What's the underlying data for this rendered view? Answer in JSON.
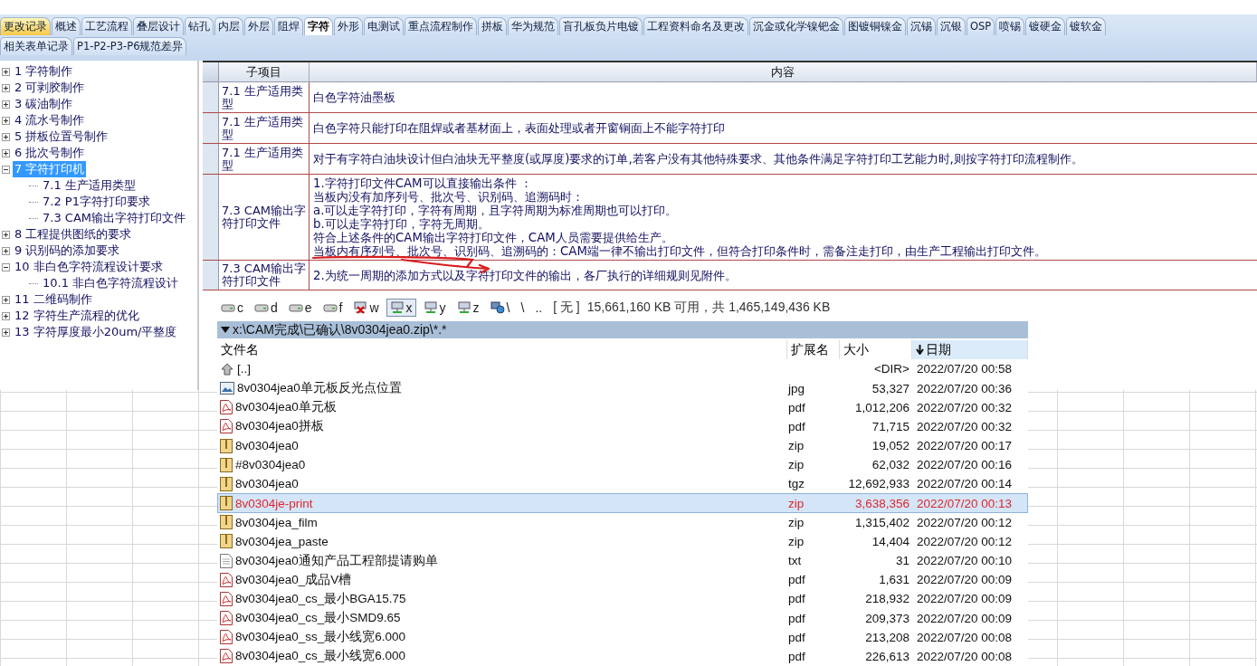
{
  "tab_rows": [
    {
      "tabs": [
        {
          "label": "更改记录",
          "selected": false,
          "highlighted": true
        },
        {
          "label": "概述",
          "selected": false,
          "highlighted": false
        },
        {
          "label": "工艺流程",
          "selected": false,
          "highlighted": false
        },
        {
          "label": "叠层设计",
          "selected": false,
          "highlighted": false
        },
        {
          "label": "钻孔",
          "selected": false,
          "highlighted": false
        },
        {
          "label": "内层",
          "selected": false,
          "highlighted": false
        },
        {
          "label": "外层",
          "selected": false,
          "highlighted": false
        },
        {
          "label": "阻焊",
          "selected": false,
          "highlighted": false
        },
        {
          "label": "字符",
          "selected": true,
          "highlighted": false
        },
        {
          "label": "外形",
          "selected": false,
          "highlighted": false
        },
        {
          "label": "电测试",
          "selected": false,
          "highlighted": false
        },
        {
          "label": "重点流程制作",
          "selected": false,
          "highlighted": false
        },
        {
          "label": "拼板",
          "selected": false,
          "highlighted": false
        },
        {
          "label": "华为规范",
          "selected": false,
          "highlighted": false
        },
        {
          "label": "盲孔板负片电镀",
          "selected": false,
          "highlighted": false
        },
        {
          "label": "工程资料命名及更改",
          "selected": false,
          "highlighted": false
        },
        {
          "label": "沉金或化学镍钯金",
          "selected": false,
          "highlighted": false
        },
        {
          "label": "图镀铜镍金",
          "selected": false,
          "highlighted": false
        },
        {
          "label": "沉锡",
          "selected": false,
          "highlighted": false
        },
        {
          "label": "沉银",
          "selected": false,
          "highlighted": false
        },
        {
          "label": "OSP",
          "selected": false,
          "highlighted": false
        },
        {
          "label": "喷锡",
          "selected": false,
          "highlighted": false
        },
        {
          "label": "镀硬金",
          "selected": false,
          "highlighted": false
        },
        {
          "label": "镀软金",
          "selected": false,
          "highlighted": false
        }
      ]
    },
    {
      "tabs": [
        {
          "label": "相关表单记录",
          "selected": false,
          "highlighted": false
        },
        {
          "label": "P1-P2-P3-P6规范差异",
          "selected": false,
          "highlighted": false
        }
      ]
    }
  ],
  "tree": [
    {
      "label": "1 字符制作",
      "expanded": false,
      "selected": false
    },
    {
      "label": "2 可剥胶制作",
      "expanded": false,
      "selected": false
    },
    {
      "label": "3 碳油制作",
      "expanded": false,
      "selected": false
    },
    {
      "label": "4 流水号制作",
      "expanded": false,
      "selected": false
    },
    {
      "label": "5 拼板位置号制作",
      "expanded": false,
      "selected": false
    },
    {
      "label": "6 批次号制作",
      "expanded": false,
      "selected": false
    },
    {
      "label": "7 字符打印机",
      "expanded": true,
      "selected": true,
      "children": [
        {
          "label": "7.1 生产适用类型",
          "selected": false
        },
        {
          "label": "7.2 P1字符打印要求",
          "selected": false
        },
        {
          "label": "7.3 CAM输出字符打印文件",
          "selected": false
        }
      ]
    },
    {
      "label": "8 工程提供图纸的要求",
      "expanded": false,
      "selected": false
    },
    {
      "label": "9 识别码的添加要求",
      "expanded": false,
      "selected": false
    },
    {
      "label": "10 非白色字符流程设计要求",
      "expanded": true,
      "selected": false,
      "children": [
        {
          "label": "10.1 非白色字符流程设计",
          "selected": false
        }
      ]
    },
    {
      "label": "11 二维码制作",
      "expanded": false,
      "selected": false
    },
    {
      "label": "12 字符生产流程的优化",
      "expanded": false,
      "selected": false
    },
    {
      "label": "13 字符厚度最小20um/平整度",
      "expanded": false,
      "selected": false
    }
  ],
  "table": {
    "columns": [
      "子项目",
      "内容"
    ],
    "rows": [
      {
        "sub_item": "7.1 生产适用类型",
        "content": [
          "白色字符油墨板"
        ]
      },
      {
        "sub_item": "7.1 生产适用类型",
        "content": [
          "白色字符只能打印在阻焊或者基材面上，表面处理或者开窗铜面上不能字符打印"
        ]
      },
      {
        "sub_item": "7.1 生产适用类型",
        "content": [
          "对于有字符白油块设计但白油块无平整度(或厚度)要求的订单,若客户没有其他特殊要求、其他条件满足字符打印工艺能力时,则按字符打印流程制作。"
        ]
      },
      {
        "sub_item": "7.3 CAM输出字符打印文件",
        "content": [
          "1.字符打印文件CAM可以直接输出条件 ：",
          "当板内没有加序列号、批次号、识别码、追溯码时：",
          "a.可以走字符打印，字符有周期，且字符周期为标准周期也可以打印。",
          "b.可以走字符打印，字符无周期。",
          "符合上述条件的CAM输出字符打印文件，CAM人员需要提供给生产。",
          "当板内有序列号、批次号、识别码、追溯码的：CAM端一律不输出打印文件，但符合打印条件时，需备注走打印，由生产工程输出打印文件。"
        ]
      },
      {
        "sub_item": "7.3 CAM输出字符打印文件",
        "content": [
          "2.为统一周期的添加方式以及字符打印文件的输出，各厂执行的详细规则见附件。"
        ]
      }
    ]
  },
  "file_manager": {
    "drives": [
      {
        "label": "c",
        "kind": "local",
        "selected": false
      },
      {
        "label": "d",
        "kind": "local",
        "selected": false
      },
      {
        "label": "e",
        "kind": "local",
        "selected": false
      },
      {
        "label": "f",
        "kind": "local",
        "selected": false
      },
      {
        "label": "w",
        "kind": "offline",
        "selected": false
      },
      {
        "label": "x",
        "kind": "network",
        "selected": true
      },
      {
        "label": "y",
        "kind": "network",
        "selected": false
      },
      {
        "label": "z",
        "kind": "network",
        "selected": false
      },
      {
        "label": "\\",
        "kind": "globe",
        "selected": false
      },
      {
        "label": "\\",
        "kind": "plain",
        "selected": false
      },
      {
        "label": "..",
        "kind": "plain",
        "selected": false
      }
    ],
    "volume_label": "[ 无 ]",
    "free_space": "15,661,160 KB 可用，共 1,465,149,436 KB",
    "path": "x:\\CAM完成\\已确认\\8v0304jea0.zip\\*.*",
    "columns": [
      {
        "label": "文件名",
        "sorted": false
      },
      {
        "label": "扩展名",
        "sorted": false
      },
      {
        "label": "大小",
        "sorted": false
      },
      {
        "label": "日期",
        "sorted": true
      }
    ],
    "files": [
      {
        "kind": "up",
        "name": "[..]",
        "size": "<DIR>",
        "date": "2022/07/20 00:58",
        "selected": false
      },
      {
        "kind": "image",
        "name": "8v0304jea0单元板反光点位置",
        "ext": "jpg",
        "size": "53,327",
        "date": "2022/07/20 00:36",
        "selected": false
      },
      {
        "kind": "pdf",
        "name": "8v0304jea0单元板",
        "ext": "pdf",
        "size": "1,012,206",
        "date": "2022/07/20 00:32",
        "selected": false
      },
      {
        "kind": "pdf",
        "name": "8v0304jea0拼板",
        "ext": "pdf",
        "size": "71,715",
        "date": "2022/07/20 00:32",
        "selected": false
      },
      {
        "kind": "archive",
        "name": "8v0304jea0",
        "ext": "zip",
        "size": "19,052",
        "date": "2022/07/20 00:17",
        "selected": false
      },
      {
        "kind": "archive",
        "name": "#8v0304jea0",
        "ext": "zip",
        "size": "62,032",
        "date": "2022/07/20 00:16",
        "selected": false
      },
      {
        "kind": "archive",
        "name": "8v0304jea0",
        "ext": "tgz",
        "size": "12,692,933",
        "date": "2022/07/20 00:14",
        "selected": false
      },
      {
        "kind": "archive",
        "name": "8v0304je-print",
        "ext": "zip",
        "size": "3,638,356",
        "date": "2022/07/20 00:13",
        "selected": true
      },
      {
        "kind": "archive",
        "name": "8v0304jea_film",
        "ext": "zip",
        "size": "1,315,402",
        "date": "2022/07/20 00:12",
        "selected": false
      },
      {
        "kind": "archive",
        "name": "8v0304jea_paste",
        "ext": "zip",
        "size": "14,404",
        "date": "2022/07/20 00:12",
        "selected": false
      },
      {
        "kind": "text",
        "name": "8v0304jea0通知产品工程部提请购单",
        "ext": "txt",
        "size": "31",
        "date": "2022/07/20 00:10",
        "selected": false
      },
      {
        "kind": "pdf",
        "name": "8v0304jea0_成品V槽",
        "ext": "pdf",
        "size": "1,631",
        "date": "2022/07/20 00:09",
        "selected": false
      },
      {
        "kind": "pdf",
        "name": "8v0304jea0_cs_最小BGA15.75",
        "ext": "pdf",
        "size": "218,932",
        "date": "2022/07/20 00:09",
        "selected": false
      },
      {
        "kind": "pdf",
        "name": "8v0304jea0_cs_最小SMD9.65",
        "ext": "pdf",
        "size": "209,373",
        "date": "2022/07/20 00:09",
        "selected": false
      },
      {
        "kind": "pdf",
        "name": "8v0304jea0_ss_最小线宽6.000",
        "ext": "pdf",
        "size": "213,208",
        "date": "2022/07/20 00:08",
        "selected": false
      },
      {
        "kind": "pdf",
        "name": "8v0304jea0_cs_最小线宽6.000",
        "ext": "pdf",
        "size": "226,613",
        "date": "2022/07/20 00:08",
        "selected": false
      }
    ]
  }
}
